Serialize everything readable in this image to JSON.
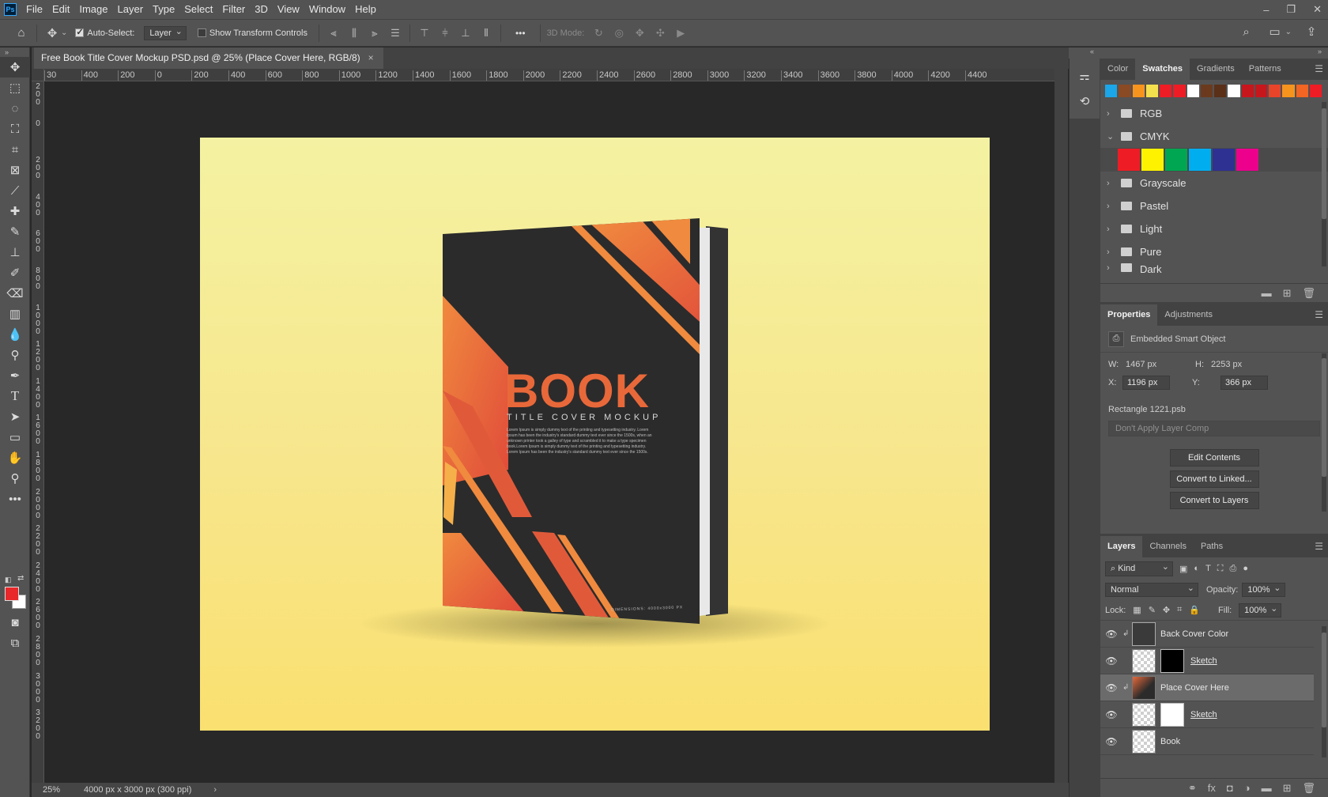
{
  "menubar": {
    "items": [
      "File",
      "Edit",
      "Image",
      "Layer",
      "Type",
      "Select",
      "Filter",
      "3D",
      "View",
      "Window",
      "Help"
    ]
  },
  "options": {
    "auto_select_label": "Auto-Select:",
    "auto_select_checked": true,
    "auto_select_target": "Layer",
    "show_transform_label": "Show Transform Controls",
    "mode_3d_label": "3D Mode:",
    "more_label": "•••"
  },
  "document": {
    "tab_title": "Free Book Title Cover Mockup PSD.psd @ 25% (Place Cover Here, RGB/8)",
    "close_label": "×"
  },
  "ruler": {
    "h_ticks": [
      "30",
      "400",
      "200",
      "0",
      "200",
      "400",
      "600",
      "800",
      "1000",
      "1200",
      "1400",
      "1600",
      "1800",
      "2000",
      "2200",
      "2400",
      "2600",
      "2800",
      "3000",
      "3200",
      "3400",
      "3600",
      "3800",
      "4000",
      "4200",
      "4400"
    ],
    "v_ticks": [
      "200",
      "0",
      "200",
      "400",
      "600",
      "800",
      "1000",
      "1200",
      "1400",
      "1600",
      "1800",
      "2000",
      "2200",
      "2400",
      "2600",
      "2800",
      "3000",
      "3200"
    ]
  },
  "book": {
    "title": "BOOK",
    "subtitle": "TITLE COVER MOCKUP",
    "body_lines": [
      "Lorem Ipsum is simply dummy text of the printing and typesetting industry. Lorem",
      "Ipsum has been the industry's standard dummy text ever since the 1500s, when an",
      "unknown printer took a galley of type and scrambled it to make a type specimen",
      "book.Lorem Ipsum is simply dummy text of the printing and typesetting industry.",
      "Lorem Ipsum has been the industry's standard dummy text ever since the 1500s."
    ],
    "dimensions": "DIMENSIONS: 4000x3000 PX"
  },
  "status": {
    "zoom": "25%",
    "doc_info": "4000 px x 3000 px (300 ppi)",
    "arrow": "›"
  },
  "swatches_panel": {
    "tabs": [
      "Color",
      "Swatches",
      "Gradients",
      "Patterns"
    ],
    "active_tab": "Swatches",
    "recent": [
      "#1aa6e8",
      "#8a4a24",
      "#f7941d",
      "#f4e04d",
      "#ee1c25",
      "#ee1c25",
      "#ffffff",
      "#6b3a1e",
      "#5a3018",
      "#ffffff",
      "#c8161d",
      "#c8161d",
      "#e8442a",
      "#f7941d",
      "#f26522",
      "#ee1c25"
    ],
    "folders_before": [
      "RGB",
      "CMYK"
    ],
    "cmyk_colors": [
      "#ee1c25",
      "#fff200",
      "#00a651",
      "#00aeef",
      "#2e3192",
      "#ec008c"
    ],
    "folders_after": [
      "Grayscale",
      "Pastel",
      "Light",
      "Pure",
      "Dark"
    ]
  },
  "properties_panel": {
    "tabs": [
      "Properties",
      "Adjustments"
    ],
    "active_tab": "Properties",
    "object_type": "Embedded Smart Object",
    "w_label": "W:",
    "w_value": "1467 px",
    "h_label": "H:",
    "h_value": "2253 px",
    "x_label": "X:",
    "x_value": "1196 px",
    "y_label": "Y:",
    "y_value": "366 px",
    "filename": "Rectangle 1221.psb",
    "layer_comp": "Don't Apply Layer Comp",
    "buttons": [
      "Edit Contents",
      "Convert to Linked...",
      "Convert to Layers"
    ]
  },
  "layers_panel": {
    "tabs": [
      "Layers",
      "Channels",
      "Paths"
    ],
    "active_tab": "Layers",
    "filter_kind": "Kind",
    "blend_mode": "Normal",
    "opacity_label": "Opacity:",
    "opacity_value": "100%",
    "lock_label": "Lock:",
    "fill_label": "Fill:",
    "fill_value": "100%",
    "layers": [
      {
        "name": "Back Cover Color",
        "thumb": "dark",
        "mask": "none",
        "selected": false,
        "clipped": true,
        "underlined": false
      },
      {
        "name": "Sketch",
        "thumb": "checker",
        "mask": "black",
        "selected": false,
        "clipped": false,
        "underlined": true
      },
      {
        "name": "Place Cover Here",
        "thumb": "smart",
        "mask": "none",
        "selected": true,
        "clipped": true,
        "underlined": false
      },
      {
        "name": "Sketch",
        "thumb": "checker",
        "mask": "white",
        "selected": false,
        "clipped": false,
        "underlined": true
      },
      {
        "name": "Book",
        "thumb": "checker",
        "mask": "none",
        "selected": false,
        "clipped": false,
        "underlined": false
      }
    ]
  },
  "colors": {
    "foreground": "#e8282a",
    "background": "#ffffff",
    "cover_dark": "#2b2b2b",
    "cover_orange": "#e8683a"
  }
}
